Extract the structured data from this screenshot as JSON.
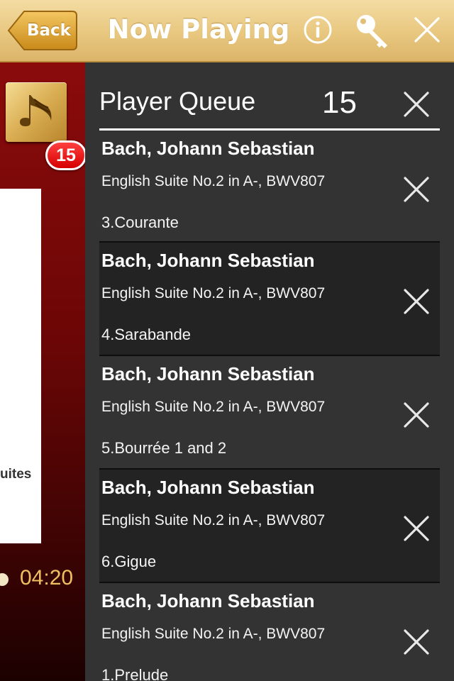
{
  "header": {
    "back_label": "Back",
    "title": "Now Playing",
    "icons": [
      "info-icon",
      "key-icon",
      "close-icon"
    ]
  },
  "player": {
    "queue_badge": "15",
    "cover_text": "uites",
    "time": "04:20"
  },
  "queue": {
    "title": "Player Queue",
    "count": "15",
    "items": [
      {
        "composer": "Bach, Johann Sebastian",
        "work": "English Suite No.2 in A-, BWV807",
        "movement": "3.Courante"
      },
      {
        "composer": "Bach, Johann Sebastian",
        "work": "English Suite No.2 in A-, BWV807",
        "movement": "4.Sarabande"
      },
      {
        "composer": "Bach, Johann Sebastian",
        "work": "English Suite No.2 in A-, BWV807",
        "movement": "5.Bourrée 1 and 2"
      },
      {
        "composer": "Bach, Johann Sebastian",
        "work": "English Suite No.2 in A-, BWV807",
        "movement": "6.Gigue"
      },
      {
        "composer": "Bach, Johann Sebastian",
        "work": "English Suite No.2 in A-, BWV807",
        "movement": "1.Prelude"
      }
    ]
  },
  "colors": {
    "header_gold": "#e8c77f",
    "player_red": "#8b0b0b",
    "queue_bg": "#333333",
    "row_alt_bg": "#232323",
    "time_text": "#f0c060",
    "badge_red": "#e60000"
  }
}
